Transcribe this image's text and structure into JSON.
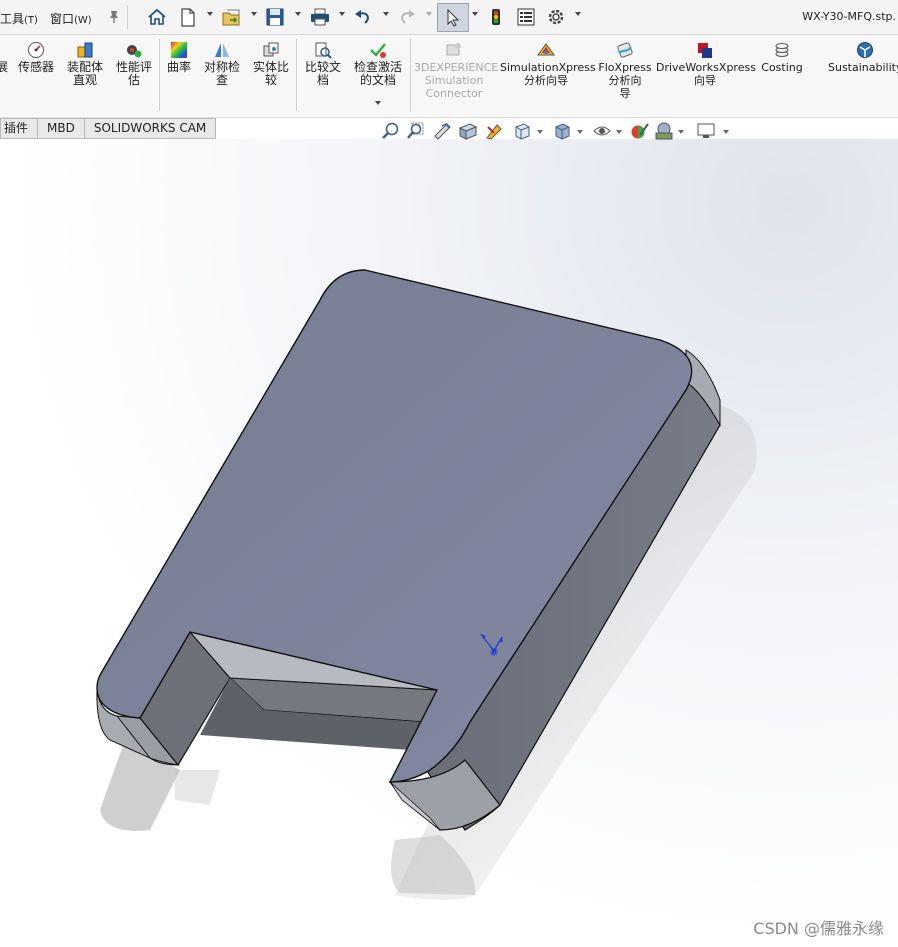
{
  "menu": {
    "tools": "工具",
    "tools_acc": "(T)",
    "window": "窗口",
    "window_acc": "(W)"
  },
  "document_title": "WX-Y30-MFQ.stp.",
  "ribbon": {
    "partial_left": "展",
    "sensors": "传感器",
    "assembly_visualization": "装配体\n直观",
    "performance_evaluation": "性能评\n估",
    "curvature": "曲率",
    "symmetry_check": "对称检\n查",
    "compare_bodies": "实体比\n较",
    "compare_documents": "比较文\n档",
    "check_active_document": "检查激活\n的文档",
    "experience_connector": "3DEXPERIENCE\nSimulation\nConnector",
    "simulationxpress": "SimulationXpress\n分析向导",
    "floxpress": "FloXpress\n分析向\n导",
    "driveworksxpress": "DriveWorksXpress\n向导",
    "costing": "Costing",
    "sustainability": "Sustainability"
  },
  "tabs": [
    "插件",
    "MBD",
    "SOLIDWORKS CAM"
  ],
  "icons": {
    "home": "home-icon",
    "new": "new-document-icon",
    "open": "open-folder-icon",
    "save": "save-icon",
    "print": "print-icon",
    "undo": "undo-icon",
    "redo": "redo-icon",
    "select": "select-arrow-icon",
    "rebuild": "rebuild-traffic-light-icon",
    "file_properties": "file-properties-icon",
    "options": "gear-icon"
  },
  "colors": {
    "model_top_face": "#7d8396",
    "model_side_face": "#6b6f7a",
    "triad": "#1f3fd6"
  },
  "watermark": "CSDN @儒雅永缘"
}
